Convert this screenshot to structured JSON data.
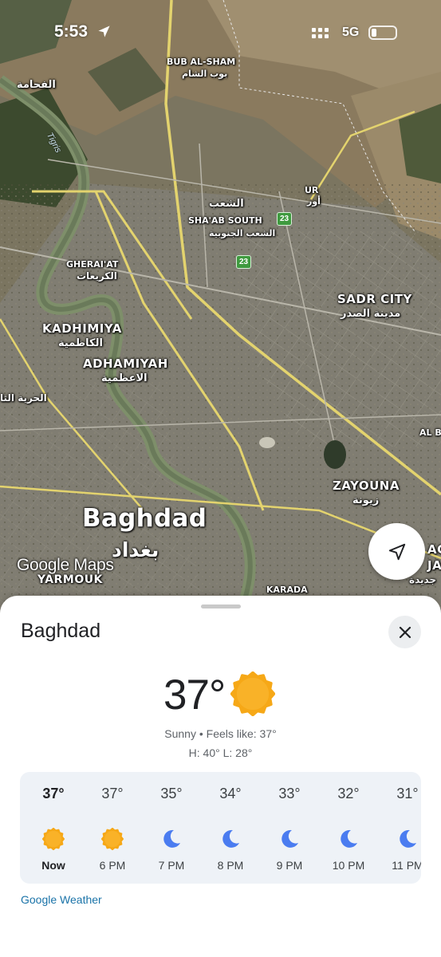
{
  "status_bar": {
    "time": "5:53",
    "network": "5G",
    "battery_level": 0.2
  },
  "map": {
    "labels": {
      "bub_al_sham": "BUB AL-SHAM",
      "bub_al_sham_ar": "بوب الشام",
      "fahama_ar": "الفحامة",
      "tigris": "Tigris",
      "shaab_ar": "الشعب",
      "shaab_south": "SHA'AB SOUTH",
      "shaab_south_ar": "الشعب الجنوبية",
      "ur": "UR",
      "ur_ar": "أور",
      "gherai_at": "GHERAI'AT",
      "gherai_at_ar": "الكريعات",
      "sadr_city": "SADR CITY",
      "sadr_city_ar": "مدينة الصدر",
      "kadhimiya": "KADHIMIYA",
      "kadhimiya_ar": "الكاظمية",
      "adhamiyah": "ADHAMIYAH",
      "adhamiyah_ar": "الاعظمية",
      "hurriya_ar": "الحرية الثا",
      "al_b": "AL B",
      "zayouna": "ZAYOUNA",
      "zayouna_ar": "زيونة",
      "baghdad": "Baghdad",
      "baghdad_ar": "بغداد",
      "yarmouk": "YARMOUK",
      "karada": "KARADA",
      "edge_ag": "AG",
      "edge_ja": "JA",
      "edge_ar": "جديدة"
    },
    "route_shields": [
      "23",
      "23"
    ],
    "logo": "Google Maps"
  },
  "sheet": {
    "title": "Baghdad",
    "current_temp": "37°",
    "condition_line": "Sunny • Feels like: 37°",
    "hilo_line": "H: 40° L: 28°",
    "hourly": [
      {
        "temp": "37°",
        "time": "Now",
        "icon": "sun-icon"
      },
      {
        "temp": "37°",
        "time": "6 PM",
        "icon": "sun-icon"
      },
      {
        "temp": "35°",
        "time": "7 PM",
        "icon": "moon-icon"
      },
      {
        "temp": "34°",
        "time": "8 PM",
        "icon": "moon-icon"
      },
      {
        "temp": "33°",
        "time": "9 PM",
        "icon": "moon-icon"
      },
      {
        "temp": "32°",
        "time": "10 PM",
        "icon": "moon-icon"
      },
      {
        "temp": "31°",
        "time": "11 PM",
        "icon": "moon-icon"
      }
    ],
    "source_link": "Google Weather"
  },
  "colors": {
    "sun": "#f5a623",
    "moon": "#4a7cf0",
    "link": "#1a73a8",
    "card_bg": "#eef2f7"
  }
}
